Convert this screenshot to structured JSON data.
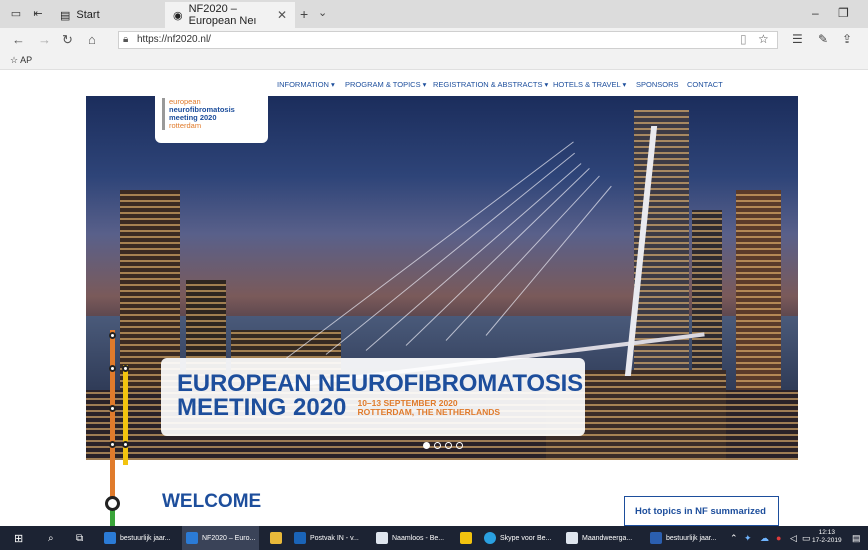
{
  "browser": {
    "inactive_tab": "Start",
    "active_tab": "NF2020 – European Neı",
    "url": "https://nf2020.nl/",
    "favorites": [
      "AP"
    ],
    "icons": {
      "back": "back-arrow-icon",
      "forward": "forward-arrow-icon",
      "refresh": "refresh-icon",
      "home": "home-icon",
      "lock": "lock-icon",
      "reading": "reading-view-icon",
      "star": "favorite-star-icon",
      "favorites": "favorites-list-icon",
      "pen": "notes-pen-icon",
      "share": "share-icon"
    }
  },
  "site": {
    "nav": [
      {
        "label": "INFORMATION",
        "has_dropdown": true
      },
      {
        "label": "PROGRAM & TOPICS",
        "has_dropdown": true
      },
      {
        "label": "REGISTRATION & ABSTRACTS",
        "has_dropdown": true
      },
      {
        "label": "HOTELS & TRAVEL",
        "has_dropdown": true
      },
      {
        "label": "SPONSORS",
        "has_dropdown": false
      },
      {
        "label": "CONTACT",
        "has_dropdown": false
      }
    ],
    "logo": {
      "line1": "european",
      "line2": "neurofibromatosis",
      "line3": "meeting 2020",
      "line4": "rotterdam"
    },
    "banner": {
      "title_line1": "EUROPEAN NEUROFIBROMATOSIS",
      "title_line2": "MEETING 2020",
      "date": "10–13 SEPTEMBER 2020",
      "place": "ROTTERDAM, THE NETHERLANDS"
    },
    "slider": {
      "slide_count": 4,
      "active_slide": 1
    },
    "welcome": "WELCOME",
    "hot_topics": "Hot topics in NF summarized",
    "colors": {
      "brand_blue": "#1d4e9c",
      "brand_orange": "#e07b2c",
      "metro_yellow": "#f2c30f",
      "metro_green": "#3aa53a"
    }
  },
  "taskbar": {
    "items": [
      {
        "label": "bestuurlijk jaar...",
        "icon": "edge-icon"
      },
      {
        "label": "NF2020 – Euro...",
        "icon": "edge-icon",
        "active": true
      },
      {
        "label": "",
        "icon": "file-explorer-icon"
      },
      {
        "label": "Postvak IN - v...",
        "icon": "outlook-icon"
      },
      {
        "label": "Naamloos - Be...",
        "icon": "paint-icon"
      },
      {
        "label": "",
        "icon": "store-icon"
      },
      {
        "label": "Skype voor Be...",
        "icon": "skype-icon"
      },
      {
        "label": "Maandweerga...",
        "icon": "calendar-icon"
      },
      {
        "label": "bestuurlijk jaar...",
        "icon": "word-icon"
      }
    ],
    "time": "12:13",
    "date": "17-2-2019"
  }
}
